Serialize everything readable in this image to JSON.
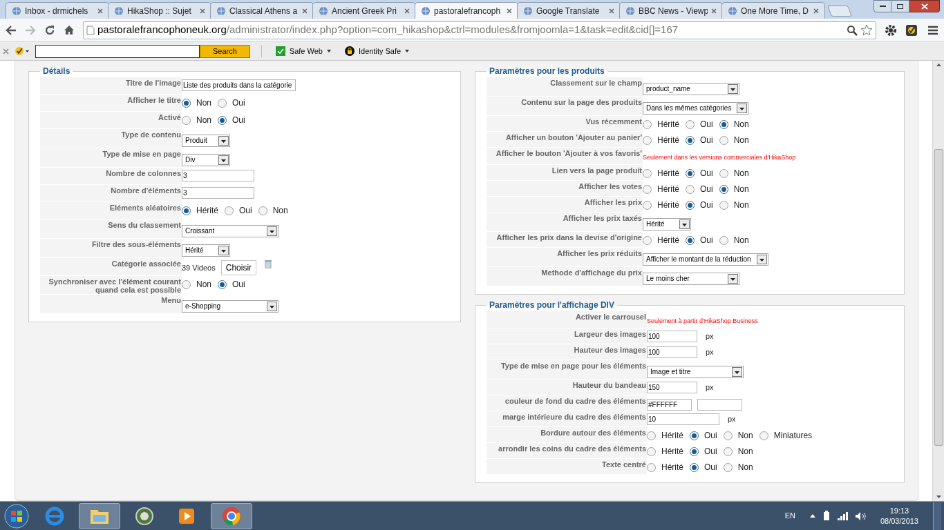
{
  "browser": {
    "tabs": [
      {
        "title": "Inbox - drmichels",
        "selected": false
      },
      {
        "title": "HikaShop :: Sujet",
        "selected": false
      },
      {
        "title": "Classical Athens a",
        "selected": false
      },
      {
        "title": "Ancient Greek Pri",
        "selected": false
      },
      {
        "title": "pastoralefrancoph",
        "selected": true
      },
      {
        "title": "Google Translate",
        "selected": false
      },
      {
        "title": "BBC News - Viewp",
        "selected": false
      },
      {
        "title": "One More Time, D",
        "selected": false
      }
    ],
    "address": {
      "domain": "pastoralefrancophoneuk.org",
      "path": "/administrator/index.php?option=com_hikashop&ctrl=modules&fromjoomla=1&task=edit&cid[]=167"
    }
  },
  "toolbar": {
    "search_button": "Search",
    "items": [
      "Safe Web",
      "Identity Safe"
    ]
  },
  "panels": [
    {
      "title": "Détails",
      "rows": [
        {
          "label": "Titre de l'image",
          "kind": "text",
          "value": "Liste des produits dans la catégorie"
        },
        {
          "label": "Afficher le titre",
          "kind": "radio",
          "options": [
            {
              "label": "Non",
              "selected": true
            },
            {
              "label": "Oui",
              "selected": false
            }
          ]
        },
        {
          "label": "Activé",
          "kind": "radio",
          "options": [
            {
              "label": "Non",
              "selected": false
            },
            {
              "label": "Oui",
              "selected": true
            }
          ]
        },
        {
          "label": "Type de contenu",
          "kind": "select",
          "value": "Produit"
        },
        {
          "label": "Type de mise en page",
          "kind": "select",
          "value": "Div"
        },
        {
          "label": "Nombre de colonnes",
          "kind": "text",
          "value": "3"
        },
        {
          "label": "Nombre d'éléments",
          "kind": "text",
          "value": "3"
        },
        {
          "label": "Eléments aléatoires",
          "kind": "radio",
          "options": [
            {
              "label": "Hérité",
              "selected": true
            },
            {
              "label": "Oui",
              "selected": false
            },
            {
              "label": "Non",
              "selected": false
            }
          ]
        },
        {
          "label": "Sens du classement",
          "kind": "select",
          "value": "Croissant"
        },
        {
          "label": "Filtre des sous-éléments",
          "kind": "select",
          "value": "Hérité"
        },
        {
          "label": "Catégorie associée",
          "kind": "category",
          "value": "39 Videos",
          "button": "Choisir"
        },
        {
          "label": "Synchroniser avec l'élément courant quand cela est possible",
          "kind": "radio",
          "options": [
            {
              "label": "Non",
              "selected": false
            },
            {
              "label": "Oui",
              "selected": true
            }
          ]
        },
        {
          "label": "Menu",
          "kind": "select",
          "value": "e-Shopping"
        }
      ]
    },
    {
      "title": "Paramètres pour les produits",
      "rows": [
        {
          "label": "Classement sur le champ",
          "kind": "select",
          "value": "product_name"
        },
        {
          "label": "Contenu sur la page des produits",
          "kind": "select",
          "value": "Dans les mêmes catégories"
        },
        {
          "label": "Vus récemment",
          "kind": "radio",
          "options": [
            {
              "label": "Hérité",
              "selected": false
            },
            {
              "label": "Oui",
              "selected": false
            },
            {
              "label": "Non",
              "selected": true
            }
          ]
        },
        {
          "label": "Afficher un bouton 'Ajouter au panier'",
          "kind": "radio",
          "options": [
            {
              "label": "Hérité",
              "selected": false
            },
            {
              "label": "Oui",
              "selected": true
            },
            {
              "label": "Non",
              "selected": false
            }
          ]
        },
        {
          "label": "Afficher le bouton 'Ajouter à vos favoris'",
          "kind": "note",
          "text": "Seulement dans les versions commerciales d'HikaShop"
        },
        {
          "label": "Lien vers la page produit",
          "kind": "radio",
          "options": [
            {
              "label": "Hérité",
              "selected": false
            },
            {
              "label": "Oui",
              "selected": true
            },
            {
              "label": "Non",
              "selected": false
            }
          ]
        },
        {
          "label": "Afficher les votes",
          "kind": "radio",
          "options": [
            {
              "label": "Hérité",
              "selected": false
            },
            {
              "label": "Oui",
              "selected": false
            },
            {
              "label": "Non",
              "selected": true
            }
          ]
        },
        {
          "label": "Afficher les prix",
          "kind": "radio",
          "options": [
            {
              "label": "Hérité",
              "selected": false
            },
            {
              "label": "Oui",
              "selected": true
            },
            {
              "label": "Non",
              "selected": false
            }
          ]
        },
        {
          "label": "Afficher les prix taxés",
          "kind": "select",
          "value": "Hérité"
        },
        {
          "label": "Afficher les prix dans la devise d'origine",
          "kind": "radio",
          "options": [
            {
              "label": "Hérité",
              "selected": false
            },
            {
              "label": "Oui",
              "selected": true
            },
            {
              "label": "Non",
              "selected": false
            }
          ]
        },
        {
          "label": "Afficher les prix réduits",
          "kind": "select",
          "value": "Afficher le montant de la réduction"
        },
        {
          "label": "Methode d'affichage du prix",
          "kind": "select",
          "value": "Le moins cher"
        }
      ]
    },
    {
      "title": "Paramètres pour l'affichage DIV",
      "rows": [
        {
          "label": "Activer le carrousel",
          "kind": "note",
          "text": "Seulement à partir d'HikaShop Business"
        },
        {
          "label": "Largeur des images",
          "kind": "text",
          "value": "100",
          "unit": "px"
        },
        {
          "label": "Hauteur des images",
          "kind": "text",
          "value": "100",
          "unit": "px"
        },
        {
          "label": "Type de mise en page pour les éléments",
          "kind": "select",
          "value": "Image et titre"
        },
        {
          "label": "Hauteur du bandeau",
          "kind": "text",
          "value": "150",
          "unit": "px"
        },
        {
          "label": "couleur de fond du cadre des éléments",
          "kind": "color",
          "value": "#FFFFFF"
        },
        {
          "label": "marge intérieure du cadre des éléments",
          "kind": "text",
          "value": "10",
          "unit": "px"
        },
        {
          "label": "Bordure autour des éléments",
          "kind": "radio",
          "options": [
            {
              "label": "Hérité",
              "selected": false
            },
            {
              "label": "Oui",
              "selected": true
            },
            {
              "label": "Non",
              "selected": false
            },
            {
              "label": "Miniatures",
              "selected": false
            }
          ]
        },
        {
          "label": "arrondir les coins du cadre des éléments",
          "kind": "radio",
          "options": [
            {
              "label": "Hérité",
              "selected": false
            },
            {
              "label": "Oui",
              "selected": true
            },
            {
              "label": "Non",
              "selected": false
            }
          ]
        },
        {
          "label": "Texte centré",
          "kind": "radio",
          "options": [
            {
              "label": "Hérité",
              "selected": false
            },
            {
              "label": "Oui",
              "selected": true
            },
            {
              "label": "Non",
              "selected": false
            }
          ]
        }
      ]
    }
  ],
  "taskbar": {
    "language": "EN",
    "time": "19:13",
    "date": "08/03/2013"
  }
}
